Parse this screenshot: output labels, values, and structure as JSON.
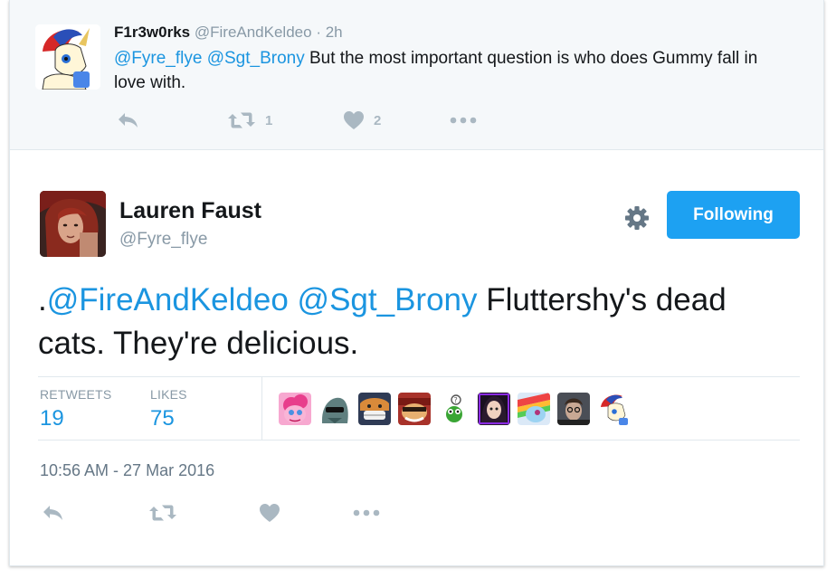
{
  "reply_tweet": {
    "fullname": "F1r3w0rks",
    "handle": "@FireAndKeldeo",
    "separator": "·",
    "time": "2h",
    "text_mention_1": "@Fyre_flye",
    "text_mention_2": "@Sgt_Brony",
    "text_body": "But the most important question is who does Gummy fall in love with.",
    "actions": {
      "reply_icon": "reply-icon",
      "retweet_icon": "retweet-icon",
      "retweet_count": "1",
      "like_icon": "heart-icon",
      "like_count": "2",
      "more_icon": "more-dots-icon"
    }
  },
  "main_tweet": {
    "fullname": "Lauren Faust",
    "handle": "@Fyre_flye",
    "settings_icon": "gear-icon",
    "follow_button_label": "Following",
    "text_prefix": ".",
    "text_mention_1": "@FireAndKeldeo",
    "text_mention_2": "@Sgt_Brony",
    "text_body": "Fluttershy's dead cats. They're delicious.",
    "stats": {
      "retweets_label": "RETWEETS",
      "retweets_value": "19",
      "likes_label": "LIKES",
      "likes_value": "75"
    },
    "timestamp": "10:56 AM - 27 Mar 2016",
    "actions": {
      "reply_icon": "reply-icon",
      "retweet_icon": "retweet-icon",
      "like_icon": "heart-icon",
      "more_icon": "more-dots-icon"
    }
  },
  "colors": {
    "accent": "#1da1f2",
    "link": "#1b95e0",
    "muted": "#8899a6",
    "icon": "#aab8c2",
    "reply_bg": "#f5f8fa"
  }
}
